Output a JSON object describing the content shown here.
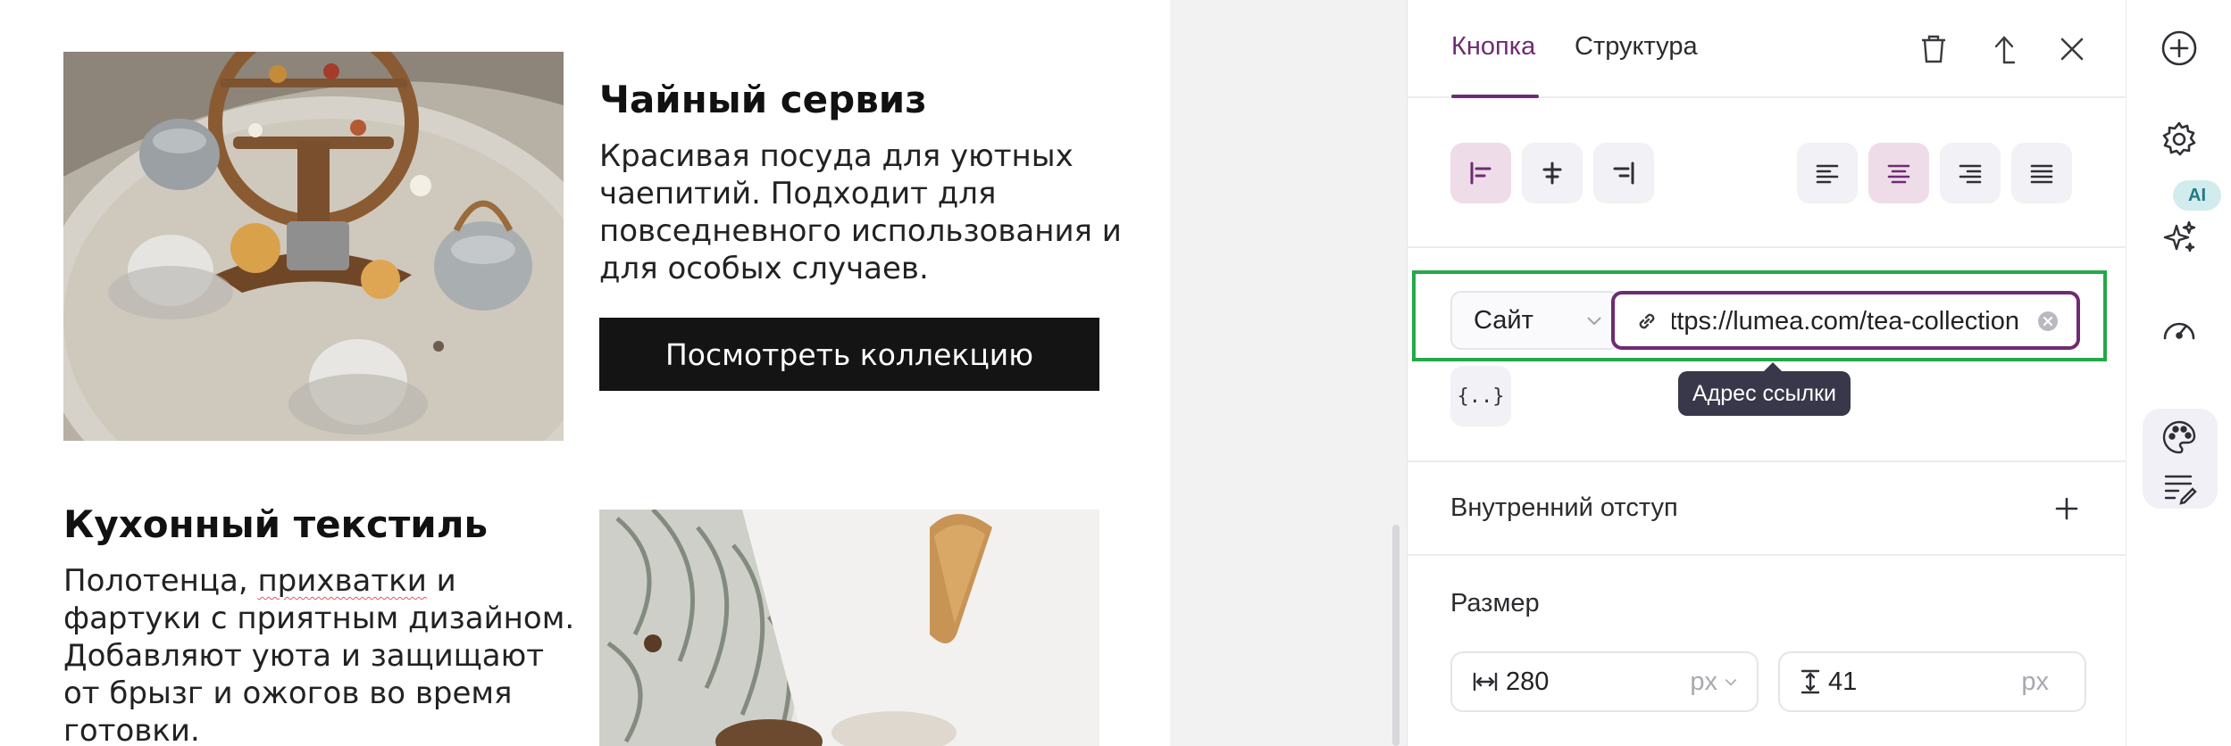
{
  "email": {
    "tea_block": {
      "title": "Чайный сервиз",
      "text": "Красивая посуда для уютных чаепитий. Подходит для повседневного использования и для особых случаев.",
      "button_label": "Посмотреть коллекцию"
    },
    "textile_block": {
      "title": "Кухонный текстиль",
      "text_part1": "Полотенца, ",
      "text_misspelled": "прихватки",
      "text_part2": " и фартуки с приятным дизайном. Добавляют уюта и защищают от брызг и ожогов во время готовки."
    }
  },
  "panel": {
    "tabs": [
      {
        "label": "Кнопка",
        "active": true
      },
      {
        "label": "Структура",
        "active": false
      }
    ],
    "alignment": {
      "block_active": "left",
      "text_active": "center"
    },
    "link": {
      "type_value": "Сайт",
      "url_value": "https://lumea.com/tea-collection",
      "tooltip": "Адрес ссылки",
      "variables_label": "{..}"
    },
    "padding": {
      "label": "Внутренний отступ"
    },
    "size": {
      "label": "Размер",
      "width_value": "280",
      "width_unit": "px",
      "height_value": "41",
      "height_unit": "px"
    }
  },
  "rail": {
    "ai_badge": "AI"
  },
  "colors": {
    "accent": "#6f2b73",
    "highlight": "#24a948",
    "button_dark": "#141414",
    "tooltip_bg": "#38384a",
    "ai_badge_bg": "#d2ecee"
  }
}
